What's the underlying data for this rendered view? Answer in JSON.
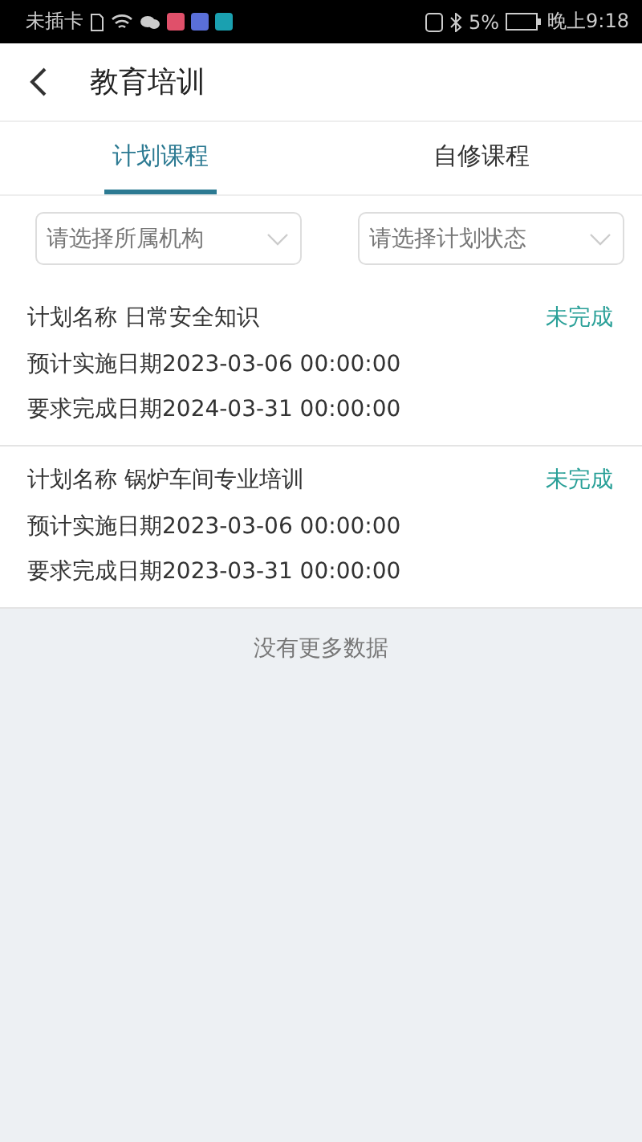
{
  "status_bar": {
    "carrier": "未插卡",
    "battery": "5%",
    "time": "晚上9:18"
  },
  "header": {
    "title": "教育培训"
  },
  "tabs": [
    {
      "label": "计划课程",
      "selected": true
    },
    {
      "label": "自修课程",
      "selected": false
    }
  ],
  "filters": [
    {
      "placeholder": "请选择所属机构"
    },
    {
      "placeholder": "请选择计划状态"
    }
  ],
  "plans": [
    {
      "name": "计划名称 日常安全知识",
      "status": "未完成",
      "start": "预计实施日期2023-03-06 00:00:00",
      "due": "要求完成日期2024-03-31 00:00:00"
    },
    {
      "name": "计划名称 锅炉车间专业培训",
      "status": "未完成",
      "start": "预计实施日期2023-03-06 00:00:00",
      "due": "要求完成日期2023-03-31 00:00:00"
    }
  ],
  "footer_note": "没有更多数据"
}
